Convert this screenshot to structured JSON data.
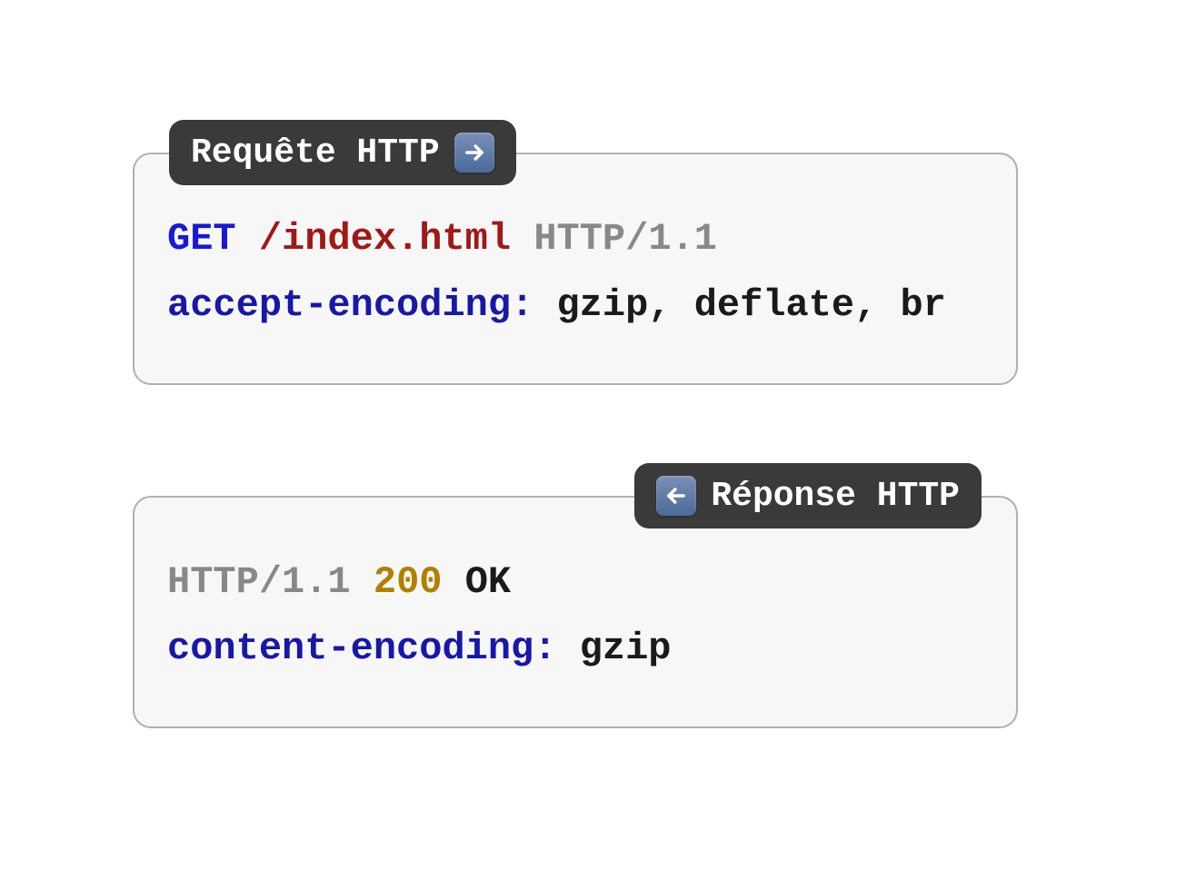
{
  "request": {
    "badge_label": "Requête HTTP",
    "method": "GET",
    "path": "/index.html",
    "protocol": "HTTP/1.1",
    "header_name": "accept-encoding:",
    "header_value": " gzip, deflate, br"
  },
  "response": {
    "badge_label": "Réponse HTTP",
    "protocol": "HTTP/1.1",
    "status_code": "200",
    "status_text": "OK",
    "header_name": "content-encoding:",
    "header_value": " gzip"
  }
}
